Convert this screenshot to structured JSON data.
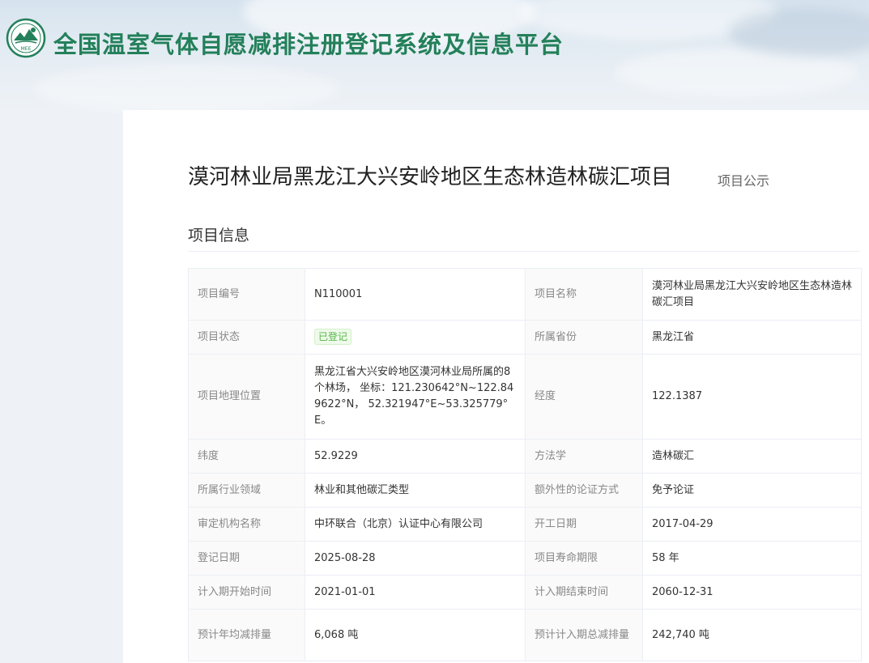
{
  "header": {
    "logo_text": "MEE",
    "site_title": "全国温室气体自愿减排注册登记系统及信息平台"
  },
  "page": {
    "title": "漠河林业局黑龙江大兴安岭地区生态林造林碳汇项目",
    "subtitle": "项目公示",
    "section_title": "项目信息"
  },
  "colors": {
    "brand_green": "#23805a",
    "status_green": "#56b54b"
  },
  "fields": {
    "project_no": {
      "label": "项目编号",
      "value": "N110001"
    },
    "project_name": {
      "label": "项目名称",
      "value": "漠河林业局黑龙江大兴安岭地区生态林造林碳汇项目"
    },
    "status": {
      "label": "项目状态",
      "value": "已登记"
    },
    "province": {
      "label": "所属省份",
      "value": "黑龙江省"
    },
    "location": {
      "label": "项目地理位置",
      "value": "黑龙江省大兴安岭地区漠河林业局所属的8个林场， 坐标：121.230642°N~122.849622°N， 52.321947°E~53.325779°E。"
    },
    "longitude": {
      "label": "经度",
      "value": "122.1387"
    },
    "latitude": {
      "label": "纬度",
      "value": "52.9229"
    },
    "methodology": {
      "label": "方法学",
      "value": "造林碳汇"
    },
    "industry": {
      "label": "所属行业领域",
      "value": "林业和其他碳汇类型"
    },
    "additionality": {
      "label": "额外性的论证方式",
      "value": "免予论证"
    },
    "validator": {
      "label": "审定机构名称",
      "value": "中环联合（北京）认证中心有限公司"
    },
    "start_date": {
      "label": "开工日期",
      "value": "2017-04-29"
    },
    "reg_date": {
      "label": "登记日期",
      "value": "2025-08-28"
    },
    "lifetime": {
      "label": "项目寿命期限",
      "value": "58 年"
    },
    "credit_start": {
      "label": "计入期开始时间",
      "value": "2021-01-01"
    },
    "credit_end": {
      "label": "计入期结束时间",
      "value": "2060-12-31"
    },
    "annual_reduction": {
      "label": "预计年均减排量",
      "value": "6,068 吨"
    },
    "total_reduction": {
      "label": "预计计入期总减排量",
      "value": "242,740 吨"
    }
  }
}
